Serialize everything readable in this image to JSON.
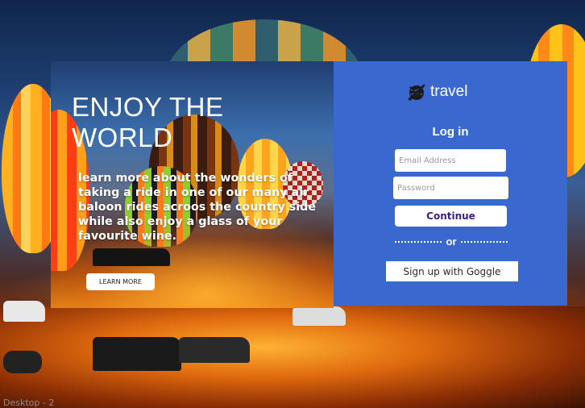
{
  "hero": {
    "title": "ENJOY THE WORLD",
    "description": "learn more about the wonders of taking a ride in one of our many air baloon rides acroos the country side while also enjoy a glass of your favourite wine.",
    "cta_label": "LEARN MORE"
  },
  "login": {
    "brand_name": "travel",
    "brand_icon": "airplane-globe-icon",
    "title": "Log in",
    "email_placeholder": "Email Address",
    "password_placeholder": "Password",
    "continue_label": "Continue",
    "divider_text": "or",
    "google_label": "Sign up with Goggle"
  },
  "canvas": {
    "frame_label": "Desktop - 2"
  },
  "colors": {
    "login_panel": "#3968cf",
    "button_bg": "#ffffff",
    "continue_text": "#3b1f8e"
  }
}
